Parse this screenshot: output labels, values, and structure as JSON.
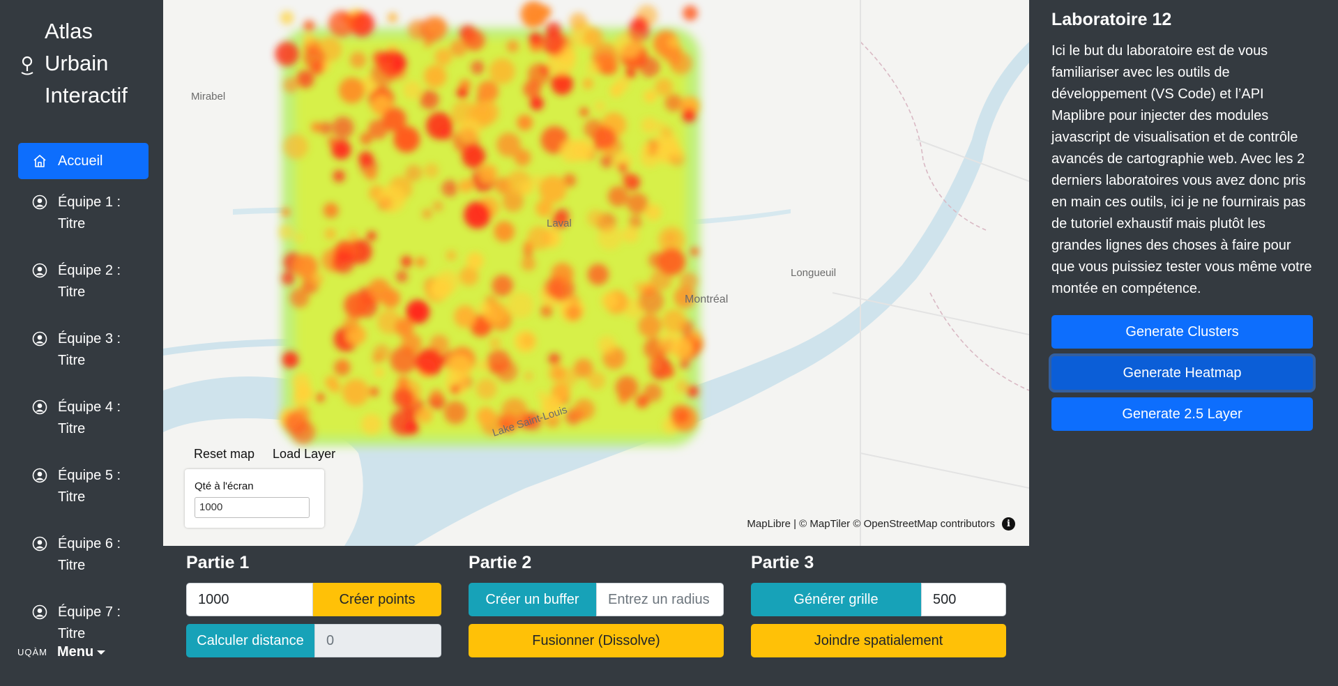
{
  "app": {
    "title_lines": [
      "Atlas",
      "Urbain",
      "Interactif"
    ]
  },
  "sidebar": {
    "items": [
      {
        "label": "Accueil",
        "icon": "home-icon",
        "active": true
      },
      {
        "label": "Équipe 1 : Titre",
        "icon": "user-circle-icon"
      },
      {
        "label": "Équipe 2 : Titre",
        "icon": "user-circle-icon"
      },
      {
        "label": "Équipe 3 : Titre",
        "icon": "user-circle-icon"
      },
      {
        "label": "Équipe 4 : Titre",
        "icon": "user-circle-icon"
      },
      {
        "label": "Équipe 5 : Titre",
        "icon": "user-circle-icon"
      },
      {
        "label": "Équipe 6 : Titre",
        "icon": "user-circle-icon"
      },
      {
        "label": "Équipe 7 : Titre",
        "icon": "user-circle-icon"
      }
    ],
    "footer": {
      "logo": "UQÀM",
      "menu": "Menu"
    }
  },
  "map": {
    "place_labels": [
      "Mirabel",
      "Laval",
      "Longueuil",
      "Montréal",
      "Lake Saint-Louis"
    ],
    "controls": {
      "reset": "Reset map",
      "load": "Load Layer"
    },
    "qty": {
      "label": "Qté à l'écran",
      "value": "1000"
    },
    "attribution": "MapLibre | © MapTiler © OpenStreetMap contributors",
    "layer": "heatmap"
  },
  "panel": {
    "title": "Laboratoire 12",
    "description": "Ici le but du laboratoire est de vous familiariser avec les outils de développement (VS Code) et l’API Maplibre pour injecter des modules javascript de visualisation et de contrôle avancés de cartographie web. Avec les 2 derniers laboratoires vous avez donc pris en main ces outils, ici je ne fournirais pas de tutoriel exhaustif mais plutôt les grandes lignes des choses à faire pour que vous puissiez tester vous même votre montée en compétence.",
    "buttons": [
      "Generate Clusters",
      "Generate Heatmap",
      "Generate 2.5 Layer"
    ]
  },
  "parts": {
    "p1": {
      "title": "Partie 1",
      "points_value": "1000",
      "create_points": "Créer points",
      "calc_distance": "Calculer distance",
      "distance_value": "0"
    },
    "p2": {
      "title": "Partie 2",
      "create_buffer": "Créer un buffer",
      "radius_placeholder": "Entrez un radius",
      "dissolve": "Fusionner (Dissolve)"
    },
    "p3": {
      "title": "Partie 3",
      "grid": "Générer grille",
      "grid_value": "500",
      "spatial_join": "Joindre spatialement"
    }
  },
  "colors": {
    "primary": "#0d6efd",
    "info": "#17a2b8",
    "warning": "#ffc107",
    "dark": "#343a40"
  }
}
